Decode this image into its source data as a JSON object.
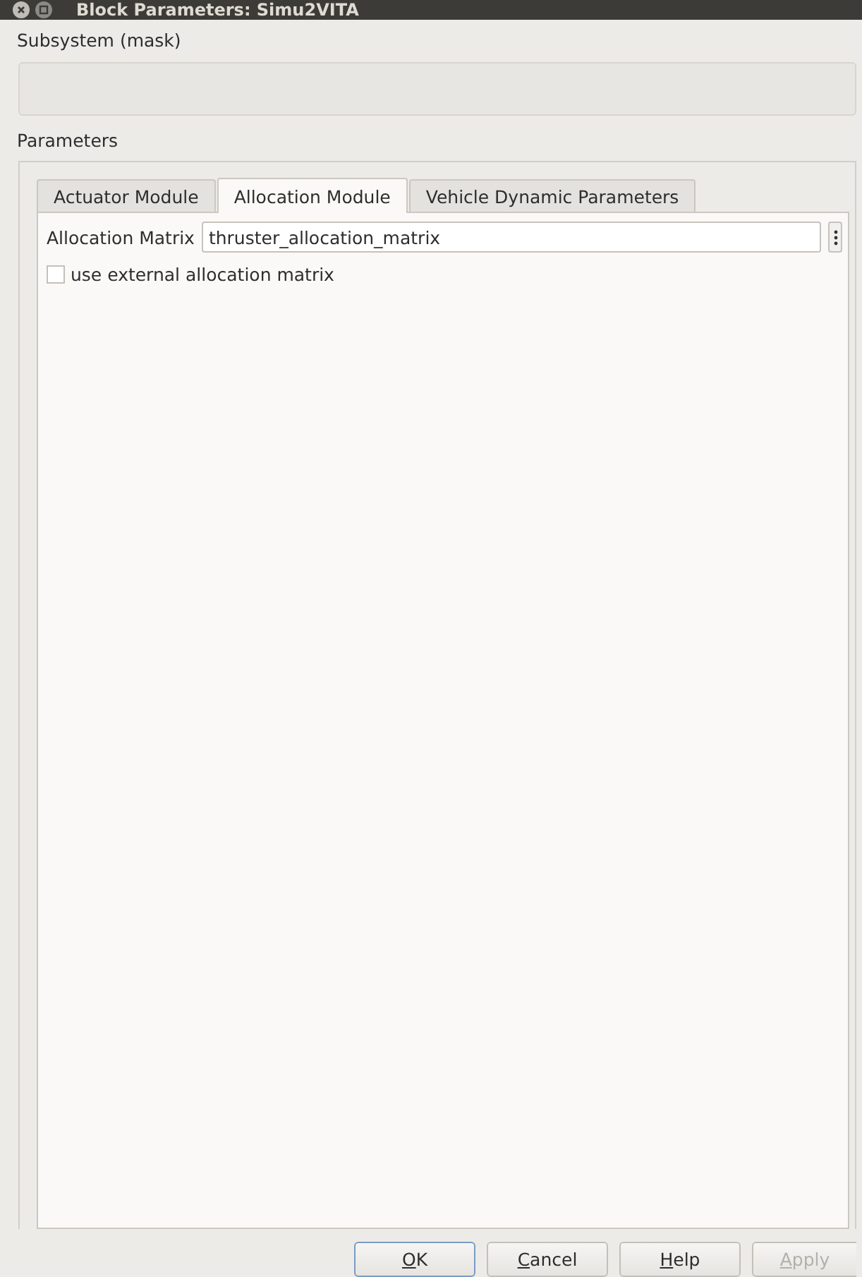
{
  "window": {
    "title": "Block Parameters: Simu2VITA"
  },
  "subsystem": {
    "label": "Subsystem (mask)"
  },
  "parameters": {
    "label": "Parameters"
  },
  "tabs": [
    {
      "label": "Actuator Module",
      "selected": false
    },
    {
      "label": "Allocation Module",
      "selected": true
    },
    {
      "label": "Vehicle Dynamic Parameters",
      "selected": false
    }
  ],
  "allocation_matrix": {
    "label": "Allocation Matrix",
    "value": "thruster_allocation_matrix"
  },
  "checkbox": {
    "label": "use external allocation matrix",
    "checked": false
  },
  "buttons": [
    {
      "key": "O",
      "rest": "K",
      "disabled": false,
      "default": true
    },
    {
      "key": "C",
      "rest": "ancel",
      "disabled": false,
      "default": false
    },
    {
      "key": "H",
      "rest": "elp",
      "disabled": false,
      "default": false
    },
    {
      "key": "A",
      "rest": "pply",
      "disabled": true,
      "default": false
    }
  ]
}
